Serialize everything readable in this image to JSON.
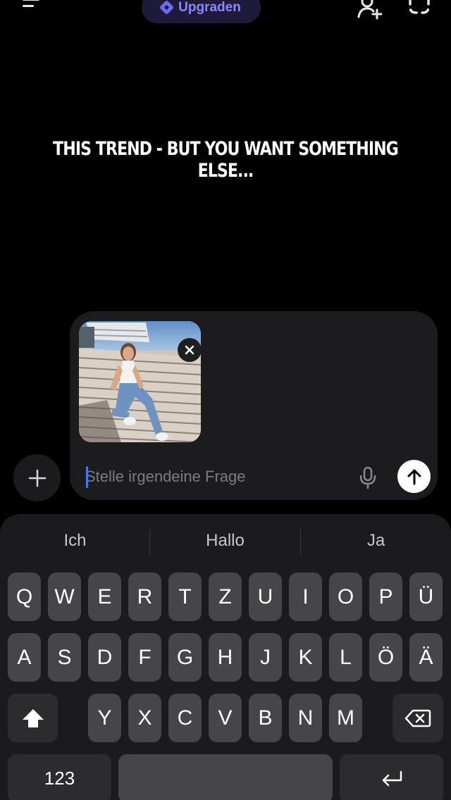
{
  "header": {
    "upgrade_label": "Upgraden"
  },
  "overlay": {
    "headline": "THIS TREND - BUT YOU WANT SOMETHING ELSE..."
  },
  "composer": {
    "placeholder": "Stelle irgendeine Frage",
    "input_value": ""
  },
  "keyboard": {
    "suggestions": [
      "Ich",
      "Hallo",
      "Ja"
    ],
    "row1": [
      "Q",
      "W",
      "E",
      "R",
      "T",
      "Z",
      "U",
      "I",
      "O",
      "P",
      "Ü"
    ],
    "row2": [
      "A",
      "S",
      "D",
      "F",
      "G",
      "H",
      "J",
      "K",
      "L",
      "Ö",
      "Ä"
    ],
    "row3": [
      "Y",
      "X",
      "C",
      "V",
      "B",
      "N",
      "M"
    ],
    "numbers_label": "123"
  },
  "colors": {
    "background": "#000000",
    "accent": "#8b87ff",
    "upgrade_bg": "#1d1a3a",
    "composer_bg": "#1c1b1d",
    "key_bg": "#464649",
    "caret": "#3a7bf6"
  },
  "icons": {
    "menu": "menu-icon",
    "upgrade": "diamond-icon",
    "add_person": "add-person-icon",
    "scan": "scan-icon",
    "plus": "plus-icon",
    "close": "close-icon",
    "mic": "microphone-icon",
    "send": "arrow-up-icon",
    "shift": "shift-icon",
    "delete": "backspace-icon",
    "return": "return-icon"
  }
}
